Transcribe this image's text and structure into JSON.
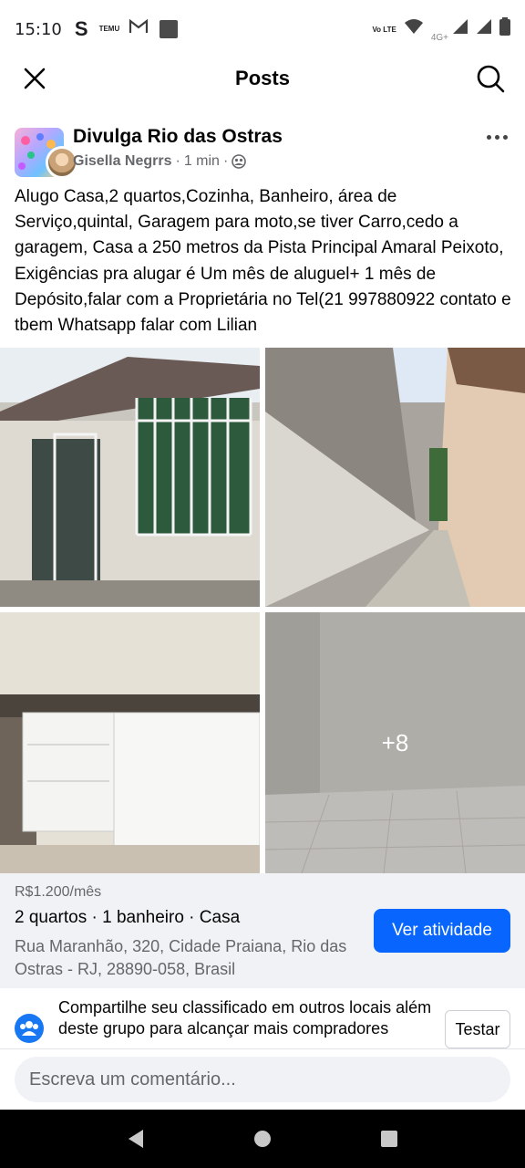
{
  "status_bar": {
    "time": "15:10",
    "s_icon": "S",
    "temu_text": "TEMU",
    "gmail_icon": "M",
    "volte_text": "Vo LTE",
    "signal_label": "4G+"
  },
  "header": {
    "title": "Posts",
    "close_icon": "close-icon",
    "search_icon": "search-icon"
  },
  "post": {
    "group_name": "Divulga Rio das Ostras",
    "author": "Gisella Negrrs",
    "time": "1 min",
    "audience_icon": "group-icon",
    "text": "Alugo Casa,2 quartos,Cozinha, Banheiro, área de Serviço,quintal, Garagem para moto,se tiver Carro,cedo a garagem, Casa a 250 metros da Pista Principal Amaral Peixoto, Exigências pra alugar é Um mês de aluguel+ 1 mês de Depósito,falar com a Proprietária no Tel(21 997880922 contato e tbem Whatsapp falar com Lilian",
    "more_photos": "+8"
  },
  "listing": {
    "price": "R$1.200/mês",
    "details": "2 quartos · 1 banheiro · Casa",
    "address": "Rua Maranhão, 320, Cidade Praiana, Rio das Ostras - RJ, 28890-058, Brasil",
    "cta_label": "Ver atividade"
  },
  "promo": {
    "text": "Compartilhe seu classificado em outros locais além deste grupo para alcançar mais compradores",
    "button_label": "Testar"
  },
  "comment": {
    "placeholder": "Escreva um comentário..."
  },
  "colors": {
    "accent": "#0866ff",
    "secondary_text": "#65676b",
    "listing_bg": "#f0f2f5"
  }
}
